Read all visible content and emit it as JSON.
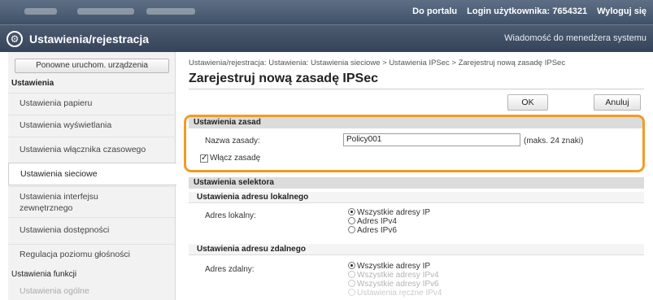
{
  "topbar": {
    "links": [
      "Do portalu",
      "Login użytkownika: 7654321",
      "Wyloguj się"
    ]
  },
  "header": {
    "title": "Ustawienia/rejestracja",
    "message": "Wiadomość do menedżera systemu"
  },
  "sidebar": {
    "restart_label": "Ponowne uruchom. urządzenia",
    "section_settings": "Ustawienia",
    "items": [
      {
        "label": "Ustawienia papieru"
      },
      {
        "label": "Ustawienia wyświetlania"
      },
      {
        "label": "Ustawienia włącznika czasowego"
      },
      {
        "label": "Ustawienia sieciowe"
      },
      {
        "label": "Ustawienia interfejsu zewnętrznego"
      },
      {
        "label": "Ustawienia dostępności"
      },
      {
        "label": "Regulacja poziomu głośności"
      }
    ],
    "section_functions": "Ustawienia funkcji",
    "faded_item": "Ustawienia ogólne"
  },
  "main": {
    "breadcrumb": "Ustawienia/rejestracja: Ustawienia: Ustawienia sieciowe > Ustawienia IPSec > Zarejestruj nową zasadę IPSec",
    "title": "Zarejestruj nową zasadę IPSec",
    "ok_label": "OK",
    "cancel_label": "Anuluj",
    "policy": {
      "heading": "Ustawienia zasad",
      "name_label": "Nazwa zasady:",
      "name_value": "Policy001",
      "name_hint": "(maks. 24 znaki)",
      "enable_label": "Włącz zasadę",
      "enable_checked": "✓"
    },
    "selector": {
      "heading": "Ustawienia selektora",
      "local": {
        "heading": "Ustawienia adresu lokalnego",
        "label": "Adres lokalny:",
        "options": [
          "Wszystkie adresy IP",
          "Adres IPv4",
          "Adres IPv6"
        ]
      },
      "remote": {
        "heading": "Ustawienia adresu zdalnego",
        "label": "Adres zdalny:",
        "options": [
          "Wszystkie adresy IP",
          "Wszystkie adresy IPv4",
          "Wszystkie adresy IPv6",
          "Ustawienia ręczne IPv4"
        ]
      }
    }
  },
  "colors": {
    "highlight": "#f39b25",
    "header": "#3f5068",
    "section": "#dcdcdc"
  }
}
